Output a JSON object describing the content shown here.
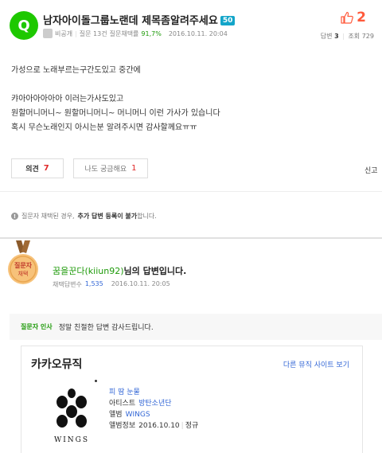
{
  "question": {
    "badge": "Q",
    "title": "남자아이돌그룹노랜데 제목좀알려주세요",
    "points": "50",
    "meta": {
      "author": "비공개",
      "question_count": "질문 13건",
      "adoption_label": "질문채택률",
      "adoption_rate": "91,7%",
      "date": "2016.10.11. 20:04"
    },
    "likes": "2",
    "answers_label": "답변",
    "answers_value": "3",
    "views_label": "조회",
    "views_value": "729",
    "body_lines": [
      "가성으로 노래부르는구간도있고 중간에",
      "",
      "캬아아아아아아 이러는가사도있고",
      "원할머니머니~ 원할머니머니~ 머니머니 이런 가사가 있습니다",
      "혹시 무슨노래인지 아시는분 알려주시면 감사할께요ㅠㅠ"
    ]
  },
  "buttons": {
    "opinion_label": "의견",
    "opinion_count": "7",
    "metoo_label": "나도 궁금해요",
    "metoo_count": "1",
    "report_label": "신고"
  },
  "notice": {
    "prefix": "질문자 채택된 경우,",
    "bold": "추가 답변 등록이 불가",
    "suffix": "합니다."
  },
  "answer": {
    "medal_line1": "질문자",
    "medal_line2": "채택",
    "author_name": "꿈을꾼다(kiiun92)",
    "author_suffix": "님의 답변입니다.",
    "meta_label": "채택답변수",
    "meta_count": "1,535",
    "date": "2016.10.11. 20:05",
    "thanks_label": "질문자 인사",
    "thanks_text": "정말 친절한 답변 감사드립니다."
  },
  "music": {
    "title": "카카오뮤직",
    "other_link": "다른 뮤직 사이트 보기",
    "album_text": "WINGS",
    "song": "피 땀 눈물",
    "artist_label": "아티스트",
    "artist": "방탄소년단",
    "album_label": "앨범",
    "album": "WINGS",
    "album_info_label": "앨범정보",
    "release_date": "2016.10.10",
    "release_type": "정규"
  },
  "colors": {
    "brand_green": "#1ec800",
    "like_red": "#ff5a3c",
    "link_blue": "#3367d6",
    "points_blue": "#13a5c9"
  }
}
